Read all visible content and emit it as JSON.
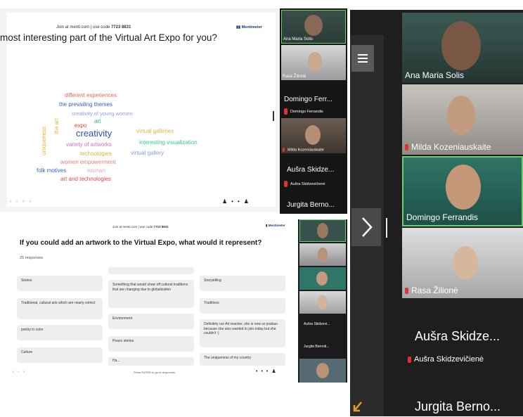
{
  "slide1": {
    "join_text": "Join at menti.com | use code",
    "code": "7723 8831",
    "brand": "Mentimeter",
    "question": "most interesting part of the Virtual Art Expo for you?",
    "words": [
      {
        "text": "different experiences",
        "color": "#e06a4e"
      },
      {
        "text": "the prevailing themes",
        "color": "#3a5fc8"
      },
      {
        "text": "creativity of young women",
        "color": "#8ea0d8"
      },
      {
        "text": "art",
        "color": "#3ab07a"
      },
      {
        "text": "expo",
        "color": "#d9483b"
      },
      {
        "text": "creativity",
        "color": "#2a4fbf"
      },
      {
        "text": "virtual galleries",
        "color": "#e3b53d"
      },
      {
        "text": "variety of artworks",
        "color": "#d46fb8"
      },
      {
        "text": "interesting visualization",
        "color": "#3cc49a"
      },
      {
        "text": "technologies",
        "color": "#d9b33d"
      },
      {
        "text": "virtual gallery",
        "color": "#8a9be0"
      },
      {
        "text": "women empowerment",
        "color": "#ea7f7f"
      },
      {
        "text": "folk motives",
        "color": "#3a5fc8"
      },
      {
        "text": "woman",
        "color": "#f2a0c2"
      },
      {
        "text": "art and technologies",
        "color": "#e04a4a"
      },
      {
        "text": "uniqueness",
        "color": "#e3b53d"
      },
      {
        "text": "the art",
        "color": "#e3b53d"
      }
    ]
  },
  "side1": {
    "tiles": [
      {
        "name": "Ana Maria Solis"
      },
      {
        "name": "Rasa Žilionė"
      }
    ],
    "cards": [
      {
        "big": "Domingo Ferr...",
        "small": "Domingo Ferrandis"
      },
      {
        "big": "Aušra Skidze...",
        "small": "Aušra Skidzevičienė"
      },
      {
        "big": "Jurgita Berno..."
      }
    ],
    "milda_tile": "Milda Kozeniauskaite"
  },
  "slide2": {
    "join_text": "Join at menti.com | use code",
    "code": "7723 8831",
    "brand": "Mentimeter",
    "question": "If you could add an artwork to the Virtual Expo, what would it represent?",
    "responses_count": "25 responses",
    "col1": [
      "Stories",
      "Traditional, cultural arts which are nearly extinct",
      "poetry in color",
      "Culture"
    ],
    "col2": [
      "Something that would show off cultural traditions that are changing due to globalization",
      "Environment",
      "Peace stories",
      "Ha..."
    ],
    "col3": [
      "Storytelling",
      "Traditions",
      "Definitely our Art teacher, she is now so jealous because she also wanted to join today but she couldn't :)",
      "The uniqueness of my country"
    ],
    "footer_hint": "Press  ENTER  to go to responses"
  },
  "side2": {
    "names": [
      "Aušra Skidzevi...",
      "Jurgita Bernoti..."
    ]
  },
  "right": {
    "tiles": [
      {
        "name": "Ana Maria Solis"
      },
      {
        "name": "Milda Kozeniauskaite"
      },
      {
        "name": "Domingo Ferrandis"
      },
      {
        "name": "Rasa Žilionė"
      }
    ],
    "card1_big": "Aušra Skidze...",
    "card1_small": "Aušra Skidzevičienė",
    "card2_big": "Jurgita Berno..."
  }
}
